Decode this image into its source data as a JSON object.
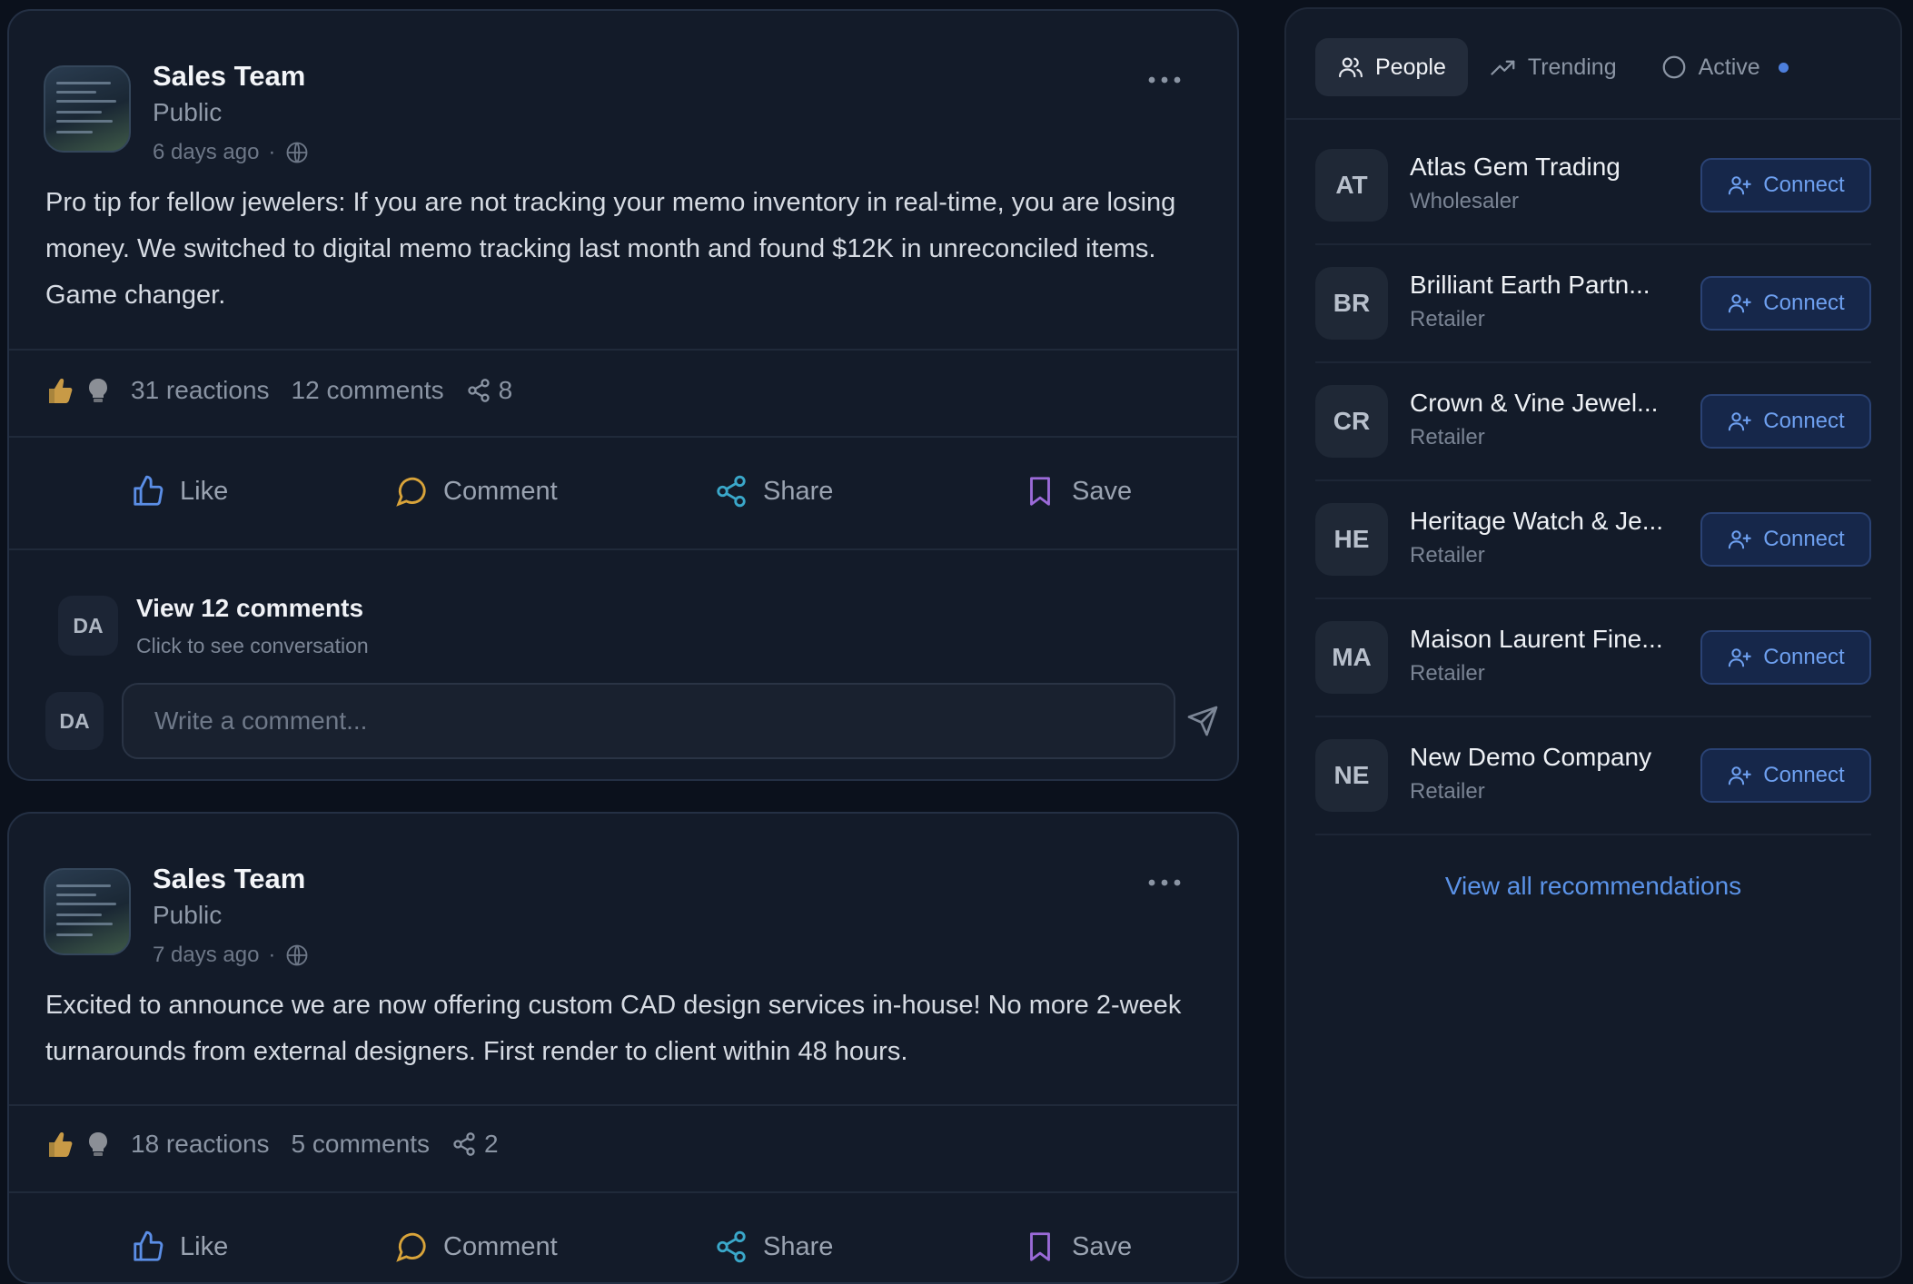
{
  "posts": [
    {
      "author": "Sales Team",
      "visibility": "Public",
      "time": "6 days ago",
      "separator": "·",
      "body": "Pro tip for fellow jewelers: If you are not tracking your memo inventory in real-time, you are losing money. We switched to digital memo tracking last month and found $12K in unreconciled items. Game changer.",
      "reactions": "31 reactions",
      "comments": "12 comments",
      "shares": "8",
      "view_comments": "View 12 comments",
      "view_comments_sub": "Click to see conversation",
      "commenter_initials": "DA",
      "comment_placeholder": "Write a comment..."
    },
    {
      "author": "Sales Team",
      "visibility": "Public",
      "time": "7 days ago",
      "separator": "·",
      "body": "Excited to announce we are now offering custom CAD design services in-house! No more 2-week turnarounds from external designers. First render to client within 48 hours.",
      "reactions": "18 reactions",
      "comments": "5 comments",
      "shares": "2"
    }
  ],
  "actions": {
    "like": "Like",
    "comment": "Comment",
    "share": "Share",
    "save": "Save"
  },
  "sidebar": {
    "tabs": [
      {
        "label": "People",
        "icon": "users-icon",
        "active": true
      },
      {
        "label": "Trending",
        "icon": "trending-up-icon",
        "active": false
      },
      {
        "label": "Active",
        "icon": "circle-icon",
        "active": false
      }
    ],
    "people": [
      {
        "initials": "AT",
        "name": "Atlas Gem Trading",
        "role": "Wholesaler"
      },
      {
        "initials": "BR",
        "name": "Brilliant Earth Partn...",
        "role": "Retailer"
      },
      {
        "initials": "CR",
        "name": "Crown & Vine Jewel...",
        "role": "Retailer"
      },
      {
        "initials": "HE",
        "name": "Heritage Watch & Je...",
        "role": "Retailer"
      },
      {
        "initials": "MA",
        "name": "Maison Laurent Fine...",
        "role": "Retailer"
      },
      {
        "initials": "NE",
        "name": "New Demo Company",
        "role": "Retailer"
      }
    ],
    "connect_label": "Connect",
    "view_all": "View all recommendations"
  },
  "colors": {
    "background": "#0b111c",
    "card": "#131b29",
    "like_icon": "#5b8ee6",
    "comment_icon": "#d9a43a",
    "share_icon": "#3aa7c9",
    "save_icon": "#9b6ad8",
    "connect": "#6ea0f0",
    "active_dot": "#4d7fdc"
  }
}
